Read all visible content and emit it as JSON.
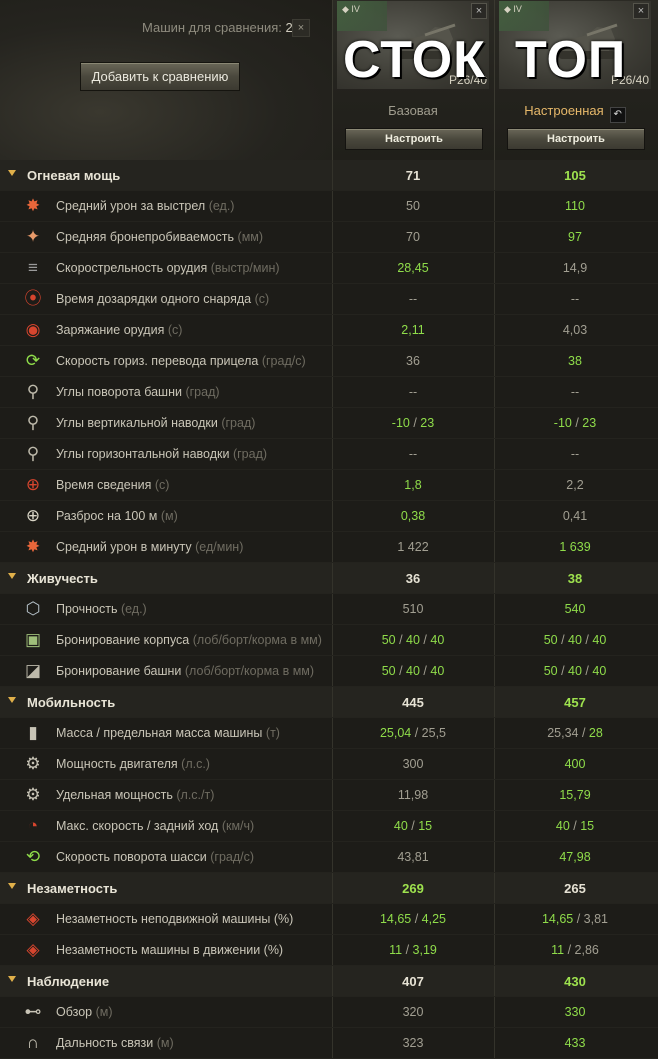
{
  "header": {
    "count_label": "Машин для сравнения:",
    "count_value": "2",
    "close_glyph": "×",
    "add_button": "Добавить к сравнению"
  },
  "columns": [
    {
      "tier": "IV",
      "tank_name": "P26/40",
      "overlay": "СТОК",
      "config": "Базовая",
      "config_color": "#9f9c8e",
      "configure_button": "Настроить",
      "close_glyph": "×"
    },
    {
      "tier": "IV",
      "tank_name": "P26/40",
      "overlay": "ТОП",
      "config": "Настроенная",
      "config_color": "#e6b86a",
      "configure_button": "Настроить",
      "close_glyph": "×",
      "reset_icon": "undo-icon"
    }
  ],
  "sections": [
    {
      "title": "Огневая мощь",
      "v1": "71",
      "v2": "105",
      "v1_green": false,
      "v2_green": true,
      "stats": [
        {
          "icon": "damage-icon",
          "label": "Средний урон за выстрел",
          "unit": "(ед.)",
          "v1": "50",
          "v2": "110",
          "g1": false,
          "g2": true
        },
        {
          "icon": "penetration-icon",
          "label": "Средняя бронепробиваемость",
          "unit": "(мм)",
          "v1": "70",
          "v2": "97",
          "g1": false,
          "g2": true
        },
        {
          "icon": "rate-of-fire-icon",
          "label": "Скорострельность орудия",
          "unit": "(выстр/мин)",
          "v1": "28,45",
          "v2": "14,9",
          "g1": true,
          "g2": false
        },
        {
          "icon": "shell-reload-icon",
          "label": "Время дозарядки одного снаряда",
          "unit": "(с)",
          "v1": "--",
          "v2": "--",
          "g1": false,
          "g2": false
        },
        {
          "icon": "reload-icon",
          "label": "Заряжание орудия",
          "unit": "(с)",
          "v1": "2,11",
          "v2": "4,03",
          "g1": true,
          "g2": false
        },
        {
          "icon": "aim-traverse-icon",
          "label": "Скорость гориз. перевода прицела",
          "unit": "(град/с)",
          "v1": "36",
          "v2": "38",
          "g1": false,
          "g2": true
        },
        {
          "icon": "turret-rotation-icon",
          "label": "Углы поворота башни",
          "unit": "(град)",
          "v1": "--",
          "v2": "--",
          "g1": false,
          "g2": false
        },
        {
          "icon": "elevation-icon",
          "label": "Углы вертикальной наводки",
          "unit": "(град)",
          "v1": [
            "-10",
            " / ",
            "23"
          ],
          "v2": [
            "-10",
            " / ",
            "23"
          ],
          "g1": true,
          "g2": true
        },
        {
          "icon": "horizontal-aim-icon",
          "label": "Углы горизонтальной наводки",
          "unit": "(град)",
          "v1": "--",
          "v2": "--",
          "g1": false,
          "g2": false
        },
        {
          "icon": "aim-time-icon",
          "label": "Время сведения",
          "unit": "(с)",
          "v1": "1,8",
          "v2": "2,2",
          "g1": true,
          "g2": false
        },
        {
          "icon": "dispersion-icon",
          "label": "Разброс на 100 м",
          "unit": "(м)",
          "v1": "0,38",
          "v2": "0,41",
          "g1": true,
          "g2": false
        },
        {
          "icon": "dpm-icon",
          "label": "Средний урон в минуту",
          "unit": "(ед/мин)",
          "v1": "1 422",
          "v2": "1 639",
          "g1": false,
          "g2": true
        }
      ]
    },
    {
      "title": "Живучесть",
      "v1": "36",
      "v2": "38",
      "v1_green": false,
      "v2_green": true,
      "stats": [
        {
          "icon": "hitpoints-icon",
          "label": "Прочность",
          "unit": "(ед.)",
          "v1": "510",
          "v2": "540",
          "g1": false,
          "g2": true
        },
        {
          "icon": "hull-armor-icon",
          "label": "Бронирование корпуса",
          "unit": "(лоб/борт/корма в мм)",
          "v1": [
            "50",
            " / ",
            "40",
            " / ",
            "40"
          ],
          "v2": [
            "50",
            " / ",
            "40",
            " / ",
            "40"
          ],
          "g1": true,
          "g2": true
        },
        {
          "icon": "turret-armor-icon",
          "label": "Бронирование башни",
          "unit": "(лоб/борт/корма в мм)",
          "v1": [
            "50",
            " / ",
            "40",
            " / ",
            "40"
          ],
          "v2": [
            "50",
            " / ",
            "40",
            " / ",
            "40"
          ],
          "g1": true,
          "g2": true
        }
      ]
    },
    {
      "title": "Мобильность",
      "v1": "445",
      "v2": "457",
      "v1_green": false,
      "v2_green": true,
      "stats": [
        {
          "icon": "weight-icon",
          "label": "Масса / предельная масса машины",
          "unit": "(т)",
          "v1": [
            "25,04",
            " / ",
            "25,5"
          ],
          "v1_mask": [
            true,
            false,
            false
          ],
          "v2": [
            "25,34",
            " / ",
            "28"
          ],
          "v2_mask": [
            false,
            false,
            true
          ]
        },
        {
          "icon": "engine-power-icon",
          "label": "Мощность двигателя",
          "unit": "(л.с.)",
          "v1": "300",
          "v2": "400",
          "g1": false,
          "g2": true
        },
        {
          "icon": "specific-power-icon",
          "label": "Удельная мощность",
          "unit": "(л.с./т)",
          "v1": "11,98",
          "v2": "15,79",
          "g1": false,
          "g2": true
        },
        {
          "icon": "speed-icon",
          "label": "Макс. скорость / задний ход",
          "unit": "(км/ч)",
          "v1": [
            "40",
            " / ",
            "15"
          ],
          "v2": [
            "40",
            " / ",
            "15"
          ],
          "g1": true,
          "g2": true
        },
        {
          "icon": "traverse-icon",
          "label": "Скорость поворота шасси",
          "unit": "(град/с)",
          "v1": "43,81",
          "v2": "47,98",
          "g1": false,
          "g2": true
        }
      ]
    },
    {
      "title": "Незаметность",
      "v1": "269",
      "v2": "265",
      "v1_green": true,
      "v2_green": false,
      "stats": [
        {
          "icon": "camo-stationary-icon",
          "label": "Незаметность неподвижной машины (%)",
          "unit": "",
          "v1": [
            "14,65",
            " / ",
            "4,25"
          ],
          "v1_mask": [
            true,
            false,
            true
          ],
          "v2": [
            "14,65",
            " / ",
            "3,81"
          ],
          "v2_mask": [
            true,
            false,
            false
          ]
        },
        {
          "icon": "camo-moving-icon",
          "label": "Незаметность машины в движении (%)",
          "unit": "",
          "v1": [
            "11",
            " / ",
            "3,19"
          ],
          "v1_mask": [
            true,
            false,
            true
          ],
          "v2": [
            "11",
            " / ",
            "2,86"
          ],
          "v2_mask": [
            true,
            false,
            false
          ]
        }
      ]
    },
    {
      "title": "Наблюдение",
      "v1": "407",
      "v2": "430",
      "v1_green": false,
      "v2_green": true,
      "stats": [
        {
          "icon": "view-range-icon",
          "label": "Обзор",
          "unit": "(м)",
          "v1": "320",
          "v2": "330",
          "g1": false,
          "g2": true
        },
        {
          "icon": "radio-range-icon",
          "label": "Дальность связи",
          "unit": "(м)",
          "v1": "323",
          "v2": "433",
          "g1": false,
          "g2": true
        }
      ]
    }
  ]
}
